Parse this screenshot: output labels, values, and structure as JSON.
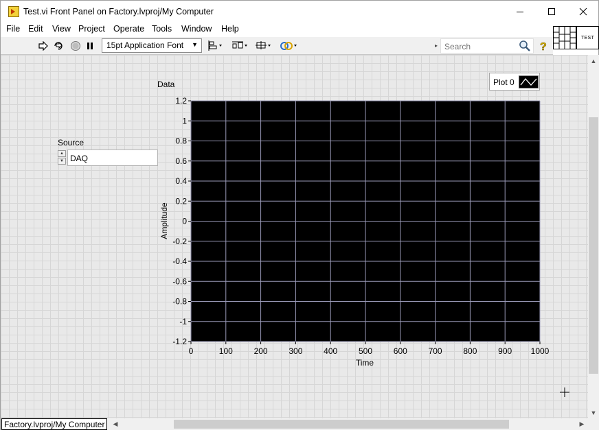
{
  "window": {
    "title": "Test.vi Front Panel on Factory.lvproj/My Computer",
    "minimize_glyph": "—",
    "maximize_glyph": "☐",
    "close_glyph": "✕"
  },
  "menu": [
    "File",
    "Edit",
    "View",
    "Project",
    "Operate",
    "Tools",
    "Window",
    "Help"
  ],
  "toolbar": {
    "font_label": "15pt Application Font",
    "search_placeholder": "Search",
    "icons": [
      "run-arrow-icon",
      "run-continuously-icon",
      "abort-icon",
      "pause-icon",
      "align-objects-icon",
      "distribute-objects-icon",
      "resize-objects-icon",
      "reorder-icon",
      "search-icon",
      "context-help-icon"
    ]
  },
  "vi_icon_text": "TEST",
  "source": {
    "label": "Source",
    "value": "DAQ"
  },
  "graph": {
    "label": "Data",
    "legend_plot": "Plot 0",
    "background": "#000000",
    "grid_color": "#9a9ab8"
  },
  "chart_data": {
    "type": "line",
    "title": "",
    "xlabel": "Time",
    "ylabel": "Amplitude",
    "xlim": [
      0,
      1000
    ],
    "ylim": [
      -1.2,
      1.2
    ],
    "x_ticks": [
      "0",
      "100",
      "200",
      "300",
      "400",
      "500",
      "600",
      "700",
      "800",
      "900",
      "1000"
    ],
    "y_ticks": [
      "1.2",
      "1",
      "0.8",
      "0.6",
      "0.4",
      "0.2",
      "0",
      "-0.2",
      "-0.4",
      "-0.6",
      "-0.8",
      "-1",
      "-1.2"
    ],
    "series": [
      {
        "name": "Plot 0",
        "x": [],
        "y": []
      }
    ],
    "grid": true,
    "legend": "top-right"
  },
  "statusbar": {
    "project": "Factory.lvproj/My Computer"
  }
}
